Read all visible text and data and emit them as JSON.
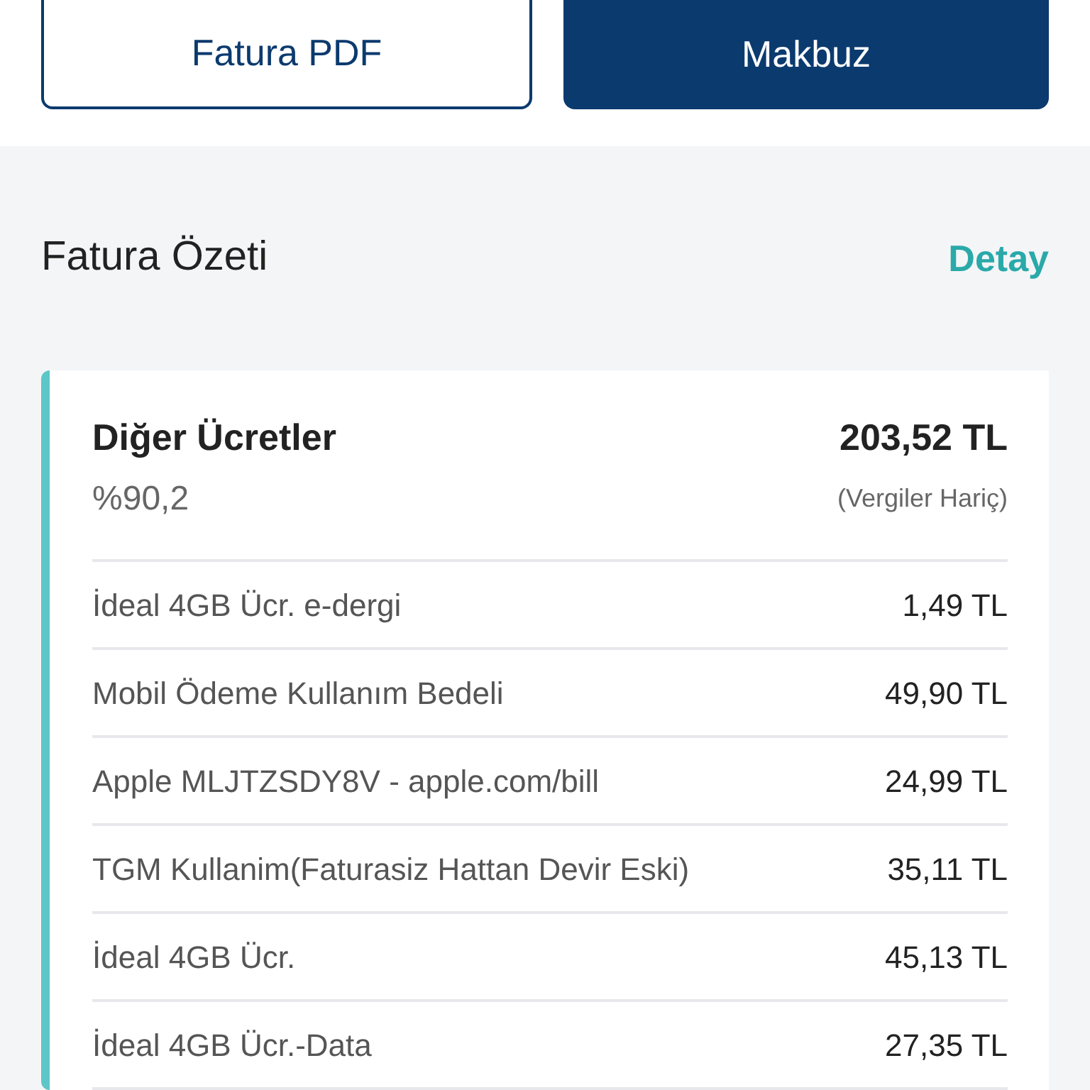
{
  "buttons": [
    {
      "label": "Fatura PDF",
      "kind": "outline"
    },
    {
      "label": "Makbuz",
      "kind": "filled"
    }
  ],
  "summary": {
    "title": "Fatura Özeti",
    "link": "Detay"
  },
  "card": {
    "title": "Diğer Ücretler",
    "percent": "%90,2",
    "amount": "203,52 TL",
    "note": "(Vergiler Hariç)",
    "rows": [
      {
        "label": "İdeal 4GB Ücr. e-dergi",
        "amount": "1,49 TL"
      },
      {
        "label": "Mobil Ödeme Kullanım Bedeli",
        "amount": "49,90 TL"
      },
      {
        "label": "Apple MLJTZSDY8V - apple.com/bill",
        "amount": "24,99 TL"
      },
      {
        "label": "TGM Kullanim(Faturasiz Hattan Devir Eski)",
        "amount": "35,11 TL"
      },
      {
        "label": "İdeal 4GB Ücr.",
        "amount": "45,13 TL"
      },
      {
        "label": "İdeal 4GB Ücr.-Data",
        "amount": "27,35 TL"
      }
    ]
  }
}
